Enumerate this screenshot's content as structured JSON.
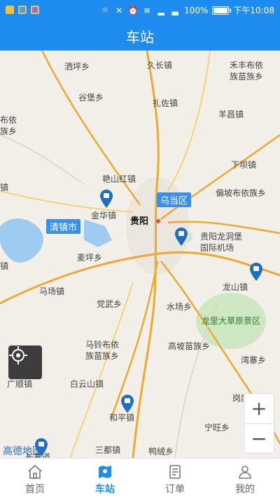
{
  "status_bar": {
    "battery": "100%",
    "time": "下午10:08"
  },
  "header": {
    "title": "车站"
  },
  "map": {
    "labels": [
      {
        "text": "洒坪乡",
        "cls": ""
      },
      {
        "text": "久长镇",
        "cls": ""
      },
      {
        "text": "禾丰布依",
        "cls": ""
      },
      {
        "text": "族苗族乡",
        "cls": ""
      },
      {
        "text": "谷堡乡",
        "cls": ""
      },
      {
        "text": "扎佐镇",
        "cls": ""
      },
      {
        "text": "羊昌镇",
        "cls": ""
      },
      {
        "text": "布依",
        "cls": ""
      },
      {
        "text": "族乡",
        "cls": ""
      },
      {
        "text": "下坝镇",
        "cls": ""
      },
      {
        "text": "艳山红镇",
        "cls": ""
      },
      {
        "text": "镇",
        "cls": ""
      },
      {
        "text": "偏坡布依族乡",
        "cls": ""
      },
      {
        "text": "金华镇",
        "cls": ""
      },
      {
        "text": "乌当区",
        "cls": "tag"
      },
      {
        "text": "贵阳",
        "cls": "big"
      },
      {
        "text": "清镇市",
        "cls": "tag"
      },
      {
        "text": "贵阳龙洞堡",
        "cls": ""
      },
      {
        "text": "国际机场",
        "cls": ""
      },
      {
        "text": "麦坪乡",
        "cls": ""
      },
      {
        "text": "镇",
        "cls": ""
      },
      {
        "text": "马场镇",
        "cls": ""
      },
      {
        "text": "龙山镇",
        "cls": ""
      },
      {
        "text": "党武乡",
        "cls": ""
      },
      {
        "text": "水场乡",
        "cls": ""
      },
      {
        "text": "龙里大草原景区",
        "cls": "green"
      },
      {
        "text": "马铃布依",
        "cls": ""
      },
      {
        "text": "族苗族乡",
        "cls": ""
      },
      {
        "text": "高坡苗族乡",
        "cls": ""
      },
      {
        "text": "湾寨乡",
        "cls": ""
      },
      {
        "text": "广顺镇",
        "cls": ""
      },
      {
        "text": "白云山镇",
        "cls": ""
      },
      {
        "text": "岗度乡",
        "cls": ""
      },
      {
        "text": "和平镇",
        "cls": ""
      },
      {
        "text": "宁旺乡",
        "cls": ""
      },
      {
        "text": "三都镇",
        "cls": ""
      },
      {
        "text": "鸭绒乡",
        "cls": ""
      },
      {
        "text": "长寨道",
        "cls": ""
      }
    ],
    "attribution": "高德地图",
    "zoom_in": "+",
    "zoom_out": "−"
  },
  "tabs": [
    {
      "label": "首页"
    },
    {
      "label": "车站"
    },
    {
      "label": "订单"
    },
    {
      "label": "我的"
    }
  ]
}
